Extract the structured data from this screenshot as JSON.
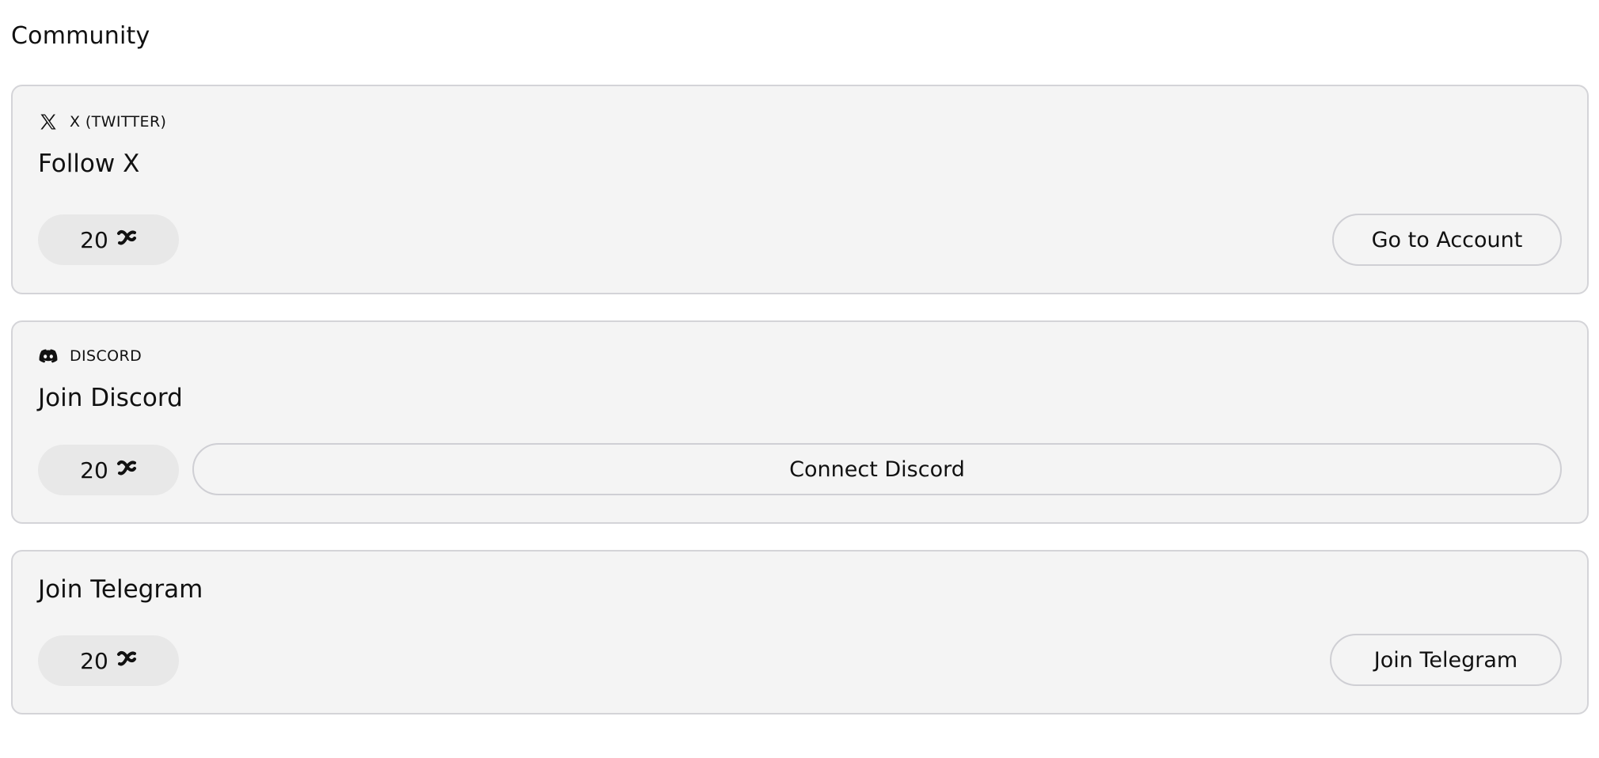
{
  "section": {
    "title": "Community"
  },
  "tasks": [
    {
      "platform_label": "X (TWITTER)",
      "platform_icon": "x-logo-icon",
      "title": "Follow X",
      "points": "20",
      "points_icon": "points-token-icon",
      "button_label": "Go to Account"
    },
    {
      "platform_label": "DISCORD",
      "platform_icon": "discord-logo-icon",
      "title": "Join Discord",
      "points": "20",
      "points_icon": "points-token-icon",
      "button_label": "Connect Discord"
    },
    {
      "title": "Join Telegram",
      "points": "20",
      "points_icon": "points-token-icon",
      "button_label": "Join Telegram"
    }
  ],
  "colors": {
    "card_background": "#f4f4f4",
    "card_border": "#d4d4d8",
    "pill_background": "#e8e8e8",
    "text": "#111111"
  }
}
